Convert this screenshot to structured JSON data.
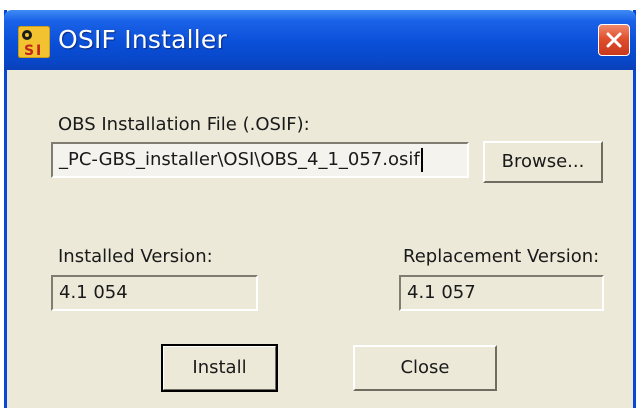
{
  "window": {
    "title": "OSIF Installer",
    "icon": "osi-app-icon",
    "close_icon": "close-icon"
  },
  "file": {
    "label": "OBS Installation File (.OSIF):",
    "value": "_PC-GBS_installer\\OSI\\OBS_4_1_057.osif",
    "browse_label": "Browse..."
  },
  "installed": {
    "label": "Installed Version:",
    "value": "4.1 054"
  },
  "replacement": {
    "label": "Replacement Version:",
    "value": "4.1 057"
  },
  "buttons": {
    "install_label": "Install",
    "close_label": "Close"
  },
  "colors": {
    "titlebar": "#0a4fd8",
    "window_bg": "#ece9d8",
    "close_button": "#e0502e"
  }
}
